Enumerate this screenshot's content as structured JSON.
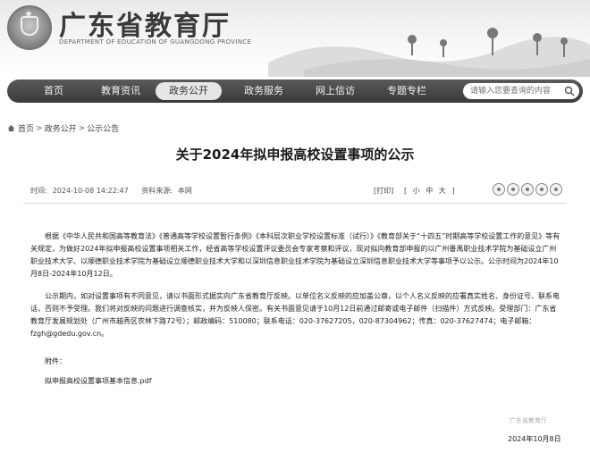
{
  "header": {
    "title": "广东省教育厅",
    "subtitle": "DEPARTMENT OF EDUCATION OF GUANGDONG PROVINCE"
  },
  "nav": {
    "items": [
      {
        "label": "首页"
      },
      {
        "label": "教育资讯"
      },
      {
        "label": "政务公开"
      },
      {
        "label": "政务服务"
      },
      {
        "label": "网上信访"
      },
      {
        "label": "专题专栏"
      }
    ],
    "active_index": 2,
    "search_placeholder": "请输入您要查询的内容"
  },
  "breadcrumb": {
    "items": [
      "首页",
      "政务公开",
      "公示公告"
    ],
    "separator": ">"
  },
  "article": {
    "title": "关于2024年拟申报高校设置事项的公示",
    "time_label": "时间:",
    "time_value": "2024-10-08 14:22:47",
    "source_label": "资料来源:",
    "source_value": "本网",
    "print_label": "[打印]",
    "font_sizes": [
      "[",
      "小",
      "中",
      "大",
      "]"
    ],
    "paragraph1": "根据《中华人民共和国高等教育法》《普通高等学校设置暂行条例》《本科层次职业学校设置标准（试行）》《教育部关于“十四五”时期高等学校设置工作的意见》等有关规定，为做好2024年拟申报高校设置事项相关工作，经省高等学校设置评议委员会专家考察和评议，现对拟向教育部申报的以广州番禺职业技术学院为基础设立广州职业技术大学、以顺德职业技术学院为基础设立顺德职业技术大学和以深圳信息职业技术学院为基础设立深圳信息职业技术大学等事项予以公示。公示时间为2024年10月8日-2024年10月12日。",
    "paragraph2": "公示期内，如对设置事项有不同意见，请以书面形式据实向广东省教育厅反映。以单位名义反映的应加盖公章，以个人名义反映的应署真实姓名、身份证号、联系电话，否则不予受理。我们将对反映的问题进行调查核实，并为反映人保密。有关书面意见请于10月12日前通过邮寄或电子邮件（扫描件）方式反映。受理部门：广东省教育厅发展规划处（广州市越秀区农林下路72号）；邮政编码：510080；联系电话：020-37627205，020-87304962；传真：020-37627474；电子邮箱：fzgh@gdedu.gov.cn。",
    "attachment_label": "附件：",
    "attachment_file": "拟申报高校设置事项基本信息.pdf",
    "stamp_text": "广东省教育厅",
    "date": "2024年10月8日"
  },
  "colors": {
    "nav_bg": "#3a3a3a",
    "nav_active_bg": "#e6e6e6",
    "header_bg": "#efefef"
  }
}
